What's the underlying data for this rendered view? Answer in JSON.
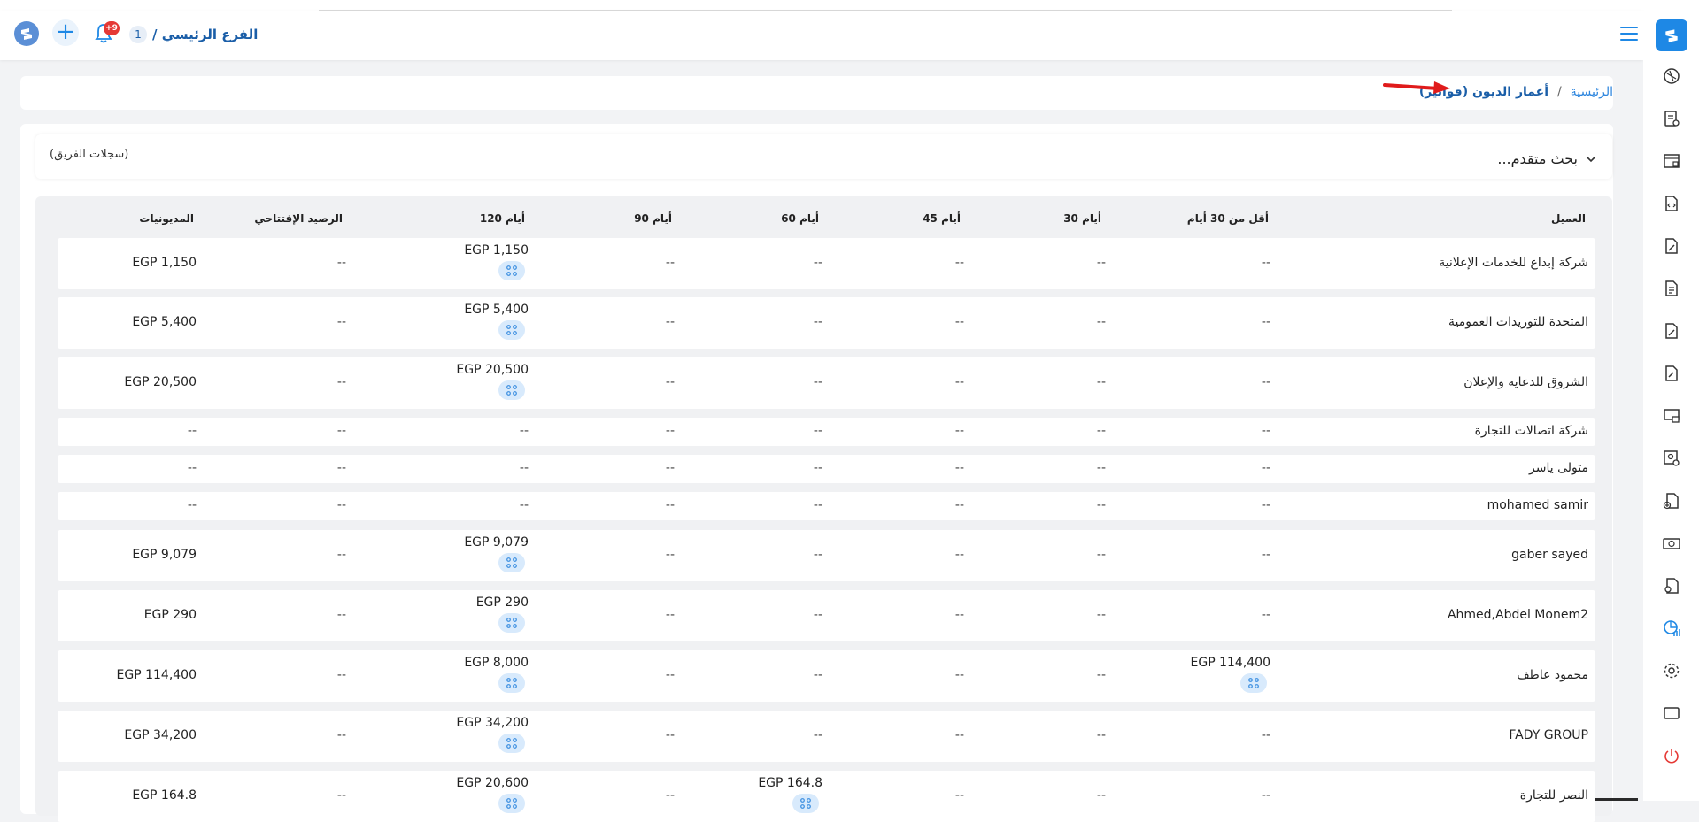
{
  "header": {
    "branch_name": "الفرع الرئيسي /",
    "branch_number": "1",
    "notification_count": "+9",
    "add_label": "+"
  },
  "breadcrumb": {
    "home": "الرئيسية",
    "separator": "/",
    "current": "أعمار الديون (فواتير)"
  },
  "filters": {
    "advanced_search": "بحث متقدم...",
    "team_records": "(سجلات الفريق)"
  },
  "table": {
    "columns": {
      "client": "العميل",
      "lt30": "أقل من 30 أيام",
      "d30": "30 أيام",
      "d45": "45 أيام",
      "d60": "60 أيام",
      "d90": "90 أيام",
      "d120": "120 أيام",
      "opening": "الرصيد الإفتتاحي",
      "debts": "المديونيات"
    },
    "rows": [
      {
        "client": "شركة إبداع للخدمات الإعلانية",
        "lt30": "--",
        "d30": "--",
        "d45": "--",
        "d60": "--",
        "d90": "--",
        "d120": "EGP 1,150",
        "opening": "--",
        "debts": "EGP 1,150"
      },
      {
        "client": "المتحدة للتوريدات العمومية",
        "lt30": "--",
        "d30": "--",
        "d45": "--",
        "d60": "--",
        "d90": "--",
        "d120": "EGP 5,400",
        "opening": "--",
        "debts": "EGP 5,400"
      },
      {
        "client": "الشروق للدعاية والإعلان",
        "lt30": "--",
        "d30": "--",
        "d45": "--",
        "d60": "--",
        "d90": "--",
        "d120": "EGP 20,500",
        "opening": "--",
        "debts": "EGP 20,500"
      },
      {
        "client": "شركة اتصالات للتجارة",
        "lt30": "--",
        "d30": "--",
        "d45": "--",
        "d60": "--",
        "d90": "--",
        "d120": "--",
        "opening": "--",
        "debts": "--"
      },
      {
        "client": "متولى ياسر",
        "lt30": "--",
        "d30": "--",
        "d45": "--",
        "d60": "--",
        "d90": "--",
        "d120": "--",
        "opening": "--",
        "debts": "--"
      },
      {
        "client": "mohamed samir",
        "lt30": "--",
        "d30": "--",
        "d45": "--",
        "d60": "--",
        "d90": "--",
        "d120": "--",
        "opening": "--",
        "debts": "--"
      },
      {
        "client": "gaber sayed",
        "lt30": "--",
        "d30": "--",
        "d45": "--",
        "d60": "--",
        "d90": "--",
        "d120": "EGP 9,079",
        "opening": "--",
        "debts": "EGP 9,079"
      },
      {
        "client": "Ahmed,Abdel Monem2",
        "lt30": "--",
        "d30": "--",
        "d45": "--",
        "d60": "--",
        "d90": "--",
        "d120": "EGP 290",
        "opening": "--",
        "debts": "EGP 290"
      },
      {
        "client": "محمود عاطف",
        "lt30": "EGP 114,400",
        "d30": "--",
        "d45": "--",
        "d60": "--",
        "d90": "--",
        "d120": "EGP 8,000",
        "opening": "--",
        "debts": "EGP 114,400"
      },
      {
        "client": "FADY GROUP",
        "lt30": "--",
        "d30": "--",
        "d45": "--",
        "d60": "--",
        "d90": "--",
        "d120": "EGP 34,200",
        "opening": "--",
        "debts": "EGP 34,200"
      },
      {
        "client": "النصر للتجارة",
        "lt30": "--",
        "d30": "--",
        "d45": "--",
        "d60": "EGP 164.8",
        "d90": "--",
        "d120": "EGP 20,600",
        "opening": "--",
        "debts": "EGP 164.8"
      }
    ]
  },
  "colors": {
    "primary": "#1e88e5",
    "chip": "#d8eafc",
    "badge": "#e53935",
    "power": "#e53935"
  }
}
